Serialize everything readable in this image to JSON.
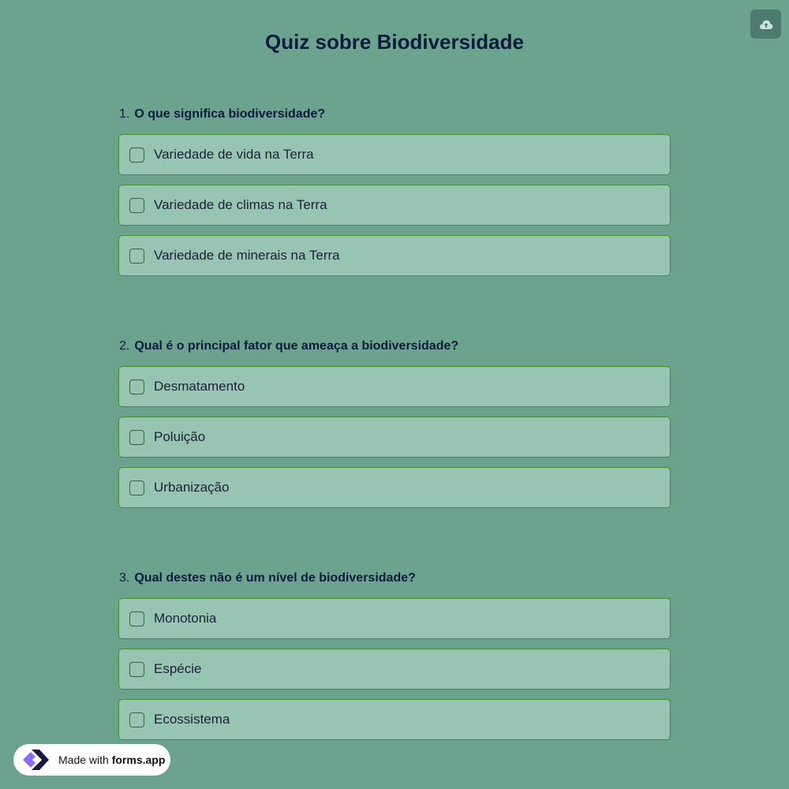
{
  "header": {
    "title": "Quiz sobre Biodiversidade",
    "save_icon": "cloud-upload-icon"
  },
  "questions": [
    {
      "number": "1.",
      "text": "O que significa biodiversidade?",
      "options": [
        "Variedade de vida na Terra",
        "Variedade de climas na Terra",
        "Variedade de minerais na Terra"
      ]
    },
    {
      "number": "2.",
      "text": "Qual é o principal fator que ameaça a biodiversidade?",
      "options": [
        "Desmatamento",
        "Poluição",
        "Urbanização"
      ]
    },
    {
      "number": "3.",
      "text": "Qual destes não é um nível de biodiversidade?",
      "options": [
        "Monotonia",
        "Espécie",
        "Ecossistema"
      ]
    }
  ],
  "footer": {
    "made_with": "Made with",
    "brand": "forms.app",
    "logo_icon": "forms-app-logo-icon"
  },
  "colors": {
    "background": "#6ba38f",
    "option_bg": "#98c4b4",
    "option_border": "#3e8f33",
    "title": "#0d1b3e",
    "save_button": "#4d7b6f"
  }
}
